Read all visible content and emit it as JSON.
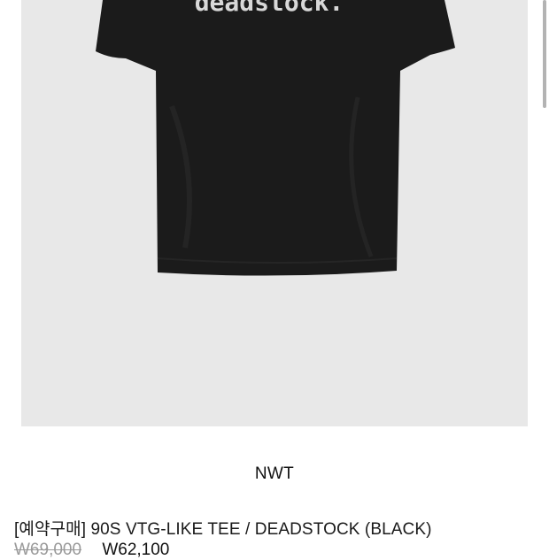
{
  "product": {
    "image_alt": "black t-shirt",
    "print_text": "deadstock.",
    "brand": "NWT",
    "name": "[예약구매] 90S VTG-LIKE TEE / DEADSTOCK (BLACK)",
    "price_original": "W69,000",
    "price_sale": "W62,100"
  },
  "colors": {
    "image_bg": "#e8e8e8",
    "shirt": "#1b1b1b",
    "print": "#d8d8d8"
  }
}
